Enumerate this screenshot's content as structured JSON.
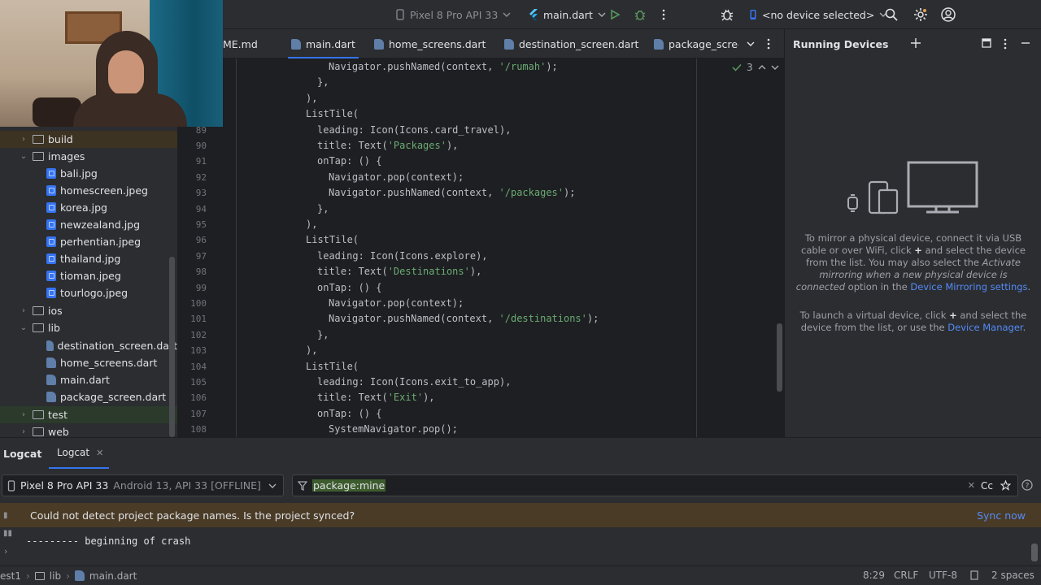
{
  "toolbar": {
    "device_config": "Pixel 8 Pro API 33",
    "run_config": "main.dart",
    "device_selector": "<no device selected>"
  },
  "tabs": [
    {
      "label": "ME.md"
    },
    {
      "label": "main.dart"
    },
    {
      "label": "home_screens.dart"
    },
    {
      "label": "destination_screen.dart"
    },
    {
      "label": "package_screen"
    }
  ],
  "project_tree": [
    {
      "label": "build",
      "kind": "folder",
      "expanded": false
    },
    {
      "label": "images",
      "kind": "folder",
      "expanded": true
    },
    {
      "label": "bali.jpg",
      "kind": "image"
    },
    {
      "label": "homescreen.jpeg",
      "kind": "image"
    },
    {
      "label": "korea.jpg",
      "kind": "image"
    },
    {
      "label": "newzealand.jpg",
      "kind": "image"
    },
    {
      "label": "perhentian.jpeg",
      "kind": "image"
    },
    {
      "label": "thailand.jpg",
      "kind": "image"
    },
    {
      "label": "tioman.jpeg",
      "kind": "image"
    },
    {
      "label": "tourlogo.jpeg",
      "kind": "image"
    },
    {
      "label": "ios",
      "kind": "folder",
      "expanded": false
    },
    {
      "label": "lib",
      "kind": "folder",
      "expanded": true
    },
    {
      "label": "destination_screen.dart",
      "kind": "dart"
    },
    {
      "label": "home_screens.dart",
      "kind": "dart"
    },
    {
      "label": "main.dart",
      "kind": "dart"
    },
    {
      "label": "package_screen.dart",
      "kind": "dart"
    },
    {
      "label": "test",
      "kind": "folder",
      "expanded": false
    },
    {
      "label": "web",
      "kind": "folder",
      "expanded": false
    }
  ],
  "editor": {
    "inspection_count": "3",
    "lines": [
      {
        "n": "",
        "indent": 4,
        "parts": [
          [
            "Navigator.pushNamed(context, ",
            ""
          ],
          [
            "'/rumah'",
            "str"
          ],
          [
            ");",
            ""
          ]
        ]
      },
      {
        "n": "",
        "indent": 3,
        "parts": [
          [
            "},",
            ""
          ]
        ]
      },
      {
        "n": "",
        "indent": 2,
        "parts": [
          [
            "),",
            ""
          ]
        ]
      },
      {
        "n": "",
        "indent": 2,
        "parts": [
          [
            "ListTile(",
            ""
          ]
        ]
      },
      {
        "n": "89",
        "indent": 3,
        "parts": [
          [
            "leading: Icon(Icons.card_travel),",
            ""
          ]
        ]
      },
      {
        "n": "90",
        "indent": 3,
        "parts": [
          [
            "title: Text(",
            ""
          ],
          [
            "'Packages'",
            "str"
          ],
          [
            "),",
            ""
          ]
        ]
      },
      {
        "n": "91",
        "indent": 3,
        "parts": [
          [
            "onTap: () {",
            ""
          ]
        ]
      },
      {
        "n": "92",
        "indent": 4,
        "parts": [
          [
            "Navigator.pop(context);",
            ""
          ]
        ]
      },
      {
        "n": "93",
        "indent": 4,
        "parts": [
          [
            "Navigator.pushNamed(context, ",
            ""
          ],
          [
            "'/packages'",
            "str"
          ],
          [
            ");",
            ""
          ]
        ]
      },
      {
        "n": "94",
        "indent": 3,
        "parts": [
          [
            "},",
            ""
          ]
        ]
      },
      {
        "n": "95",
        "indent": 2,
        "parts": [
          [
            "),",
            ""
          ]
        ]
      },
      {
        "n": "96",
        "indent": 2,
        "parts": [
          [
            "ListTile(",
            ""
          ]
        ]
      },
      {
        "n": "97",
        "indent": 3,
        "parts": [
          [
            "leading: Icon(Icons.explore),",
            ""
          ]
        ]
      },
      {
        "n": "98",
        "indent": 3,
        "parts": [
          [
            "title: Text(",
            ""
          ],
          [
            "'Destinations'",
            "str"
          ],
          [
            "),",
            ""
          ]
        ]
      },
      {
        "n": "99",
        "indent": 3,
        "parts": [
          [
            "onTap: () {",
            ""
          ]
        ]
      },
      {
        "n": "100",
        "indent": 4,
        "parts": [
          [
            "Navigator.pop(context);",
            ""
          ]
        ]
      },
      {
        "n": "101",
        "indent": 4,
        "parts": [
          [
            "Navigator.pushNamed(context, ",
            ""
          ],
          [
            "'/destinations'",
            "str"
          ],
          [
            ");",
            ""
          ]
        ]
      },
      {
        "n": "102",
        "indent": 3,
        "parts": [
          [
            "},",
            ""
          ]
        ]
      },
      {
        "n": "103",
        "indent": 2,
        "parts": [
          [
            "),",
            ""
          ]
        ]
      },
      {
        "n": "104",
        "indent": 2,
        "parts": [
          [
            "ListTile(",
            ""
          ]
        ]
      },
      {
        "n": "105",
        "indent": 3,
        "parts": [
          [
            "leading: Icon(Icons.exit_to_app),",
            ""
          ]
        ]
      },
      {
        "n": "106",
        "indent": 3,
        "parts": [
          [
            "title: Text(",
            ""
          ],
          [
            "'Exit'",
            "str"
          ],
          [
            "),",
            ""
          ]
        ]
      },
      {
        "n": "107",
        "indent": 3,
        "parts": [
          [
            "onTap: () {",
            ""
          ]
        ]
      },
      {
        "n": "108",
        "indent": 4,
        "parts": [
          [
            "SystemNavigator.pop();",
            ""
          ]
        ]
      }
    ]
  },
  "running_devices": {
    "title": "Running Devices",
    "mirror_text_1": "To mirror a physical device, connect it via USB",
    "mirror_text_2": "cable or over WiFi, click",
    "mirror_text_3": "and select the device",
    "mirror_text_4": "from the list. You may also select the",
    "mirror_text_5": "Activate",
    "mirror_text_6": "mirroring when a new physical device is",
    "mirror_text_7": "connected",
    "mirror_text_8": "option in the",
    "mirror_link": "Device Mirroring settings",
    "virtual_text_1": "To launch a virtual device, click",
    "virtual_text_2": "and select the",
    "virtual_text_3": "device from the list, or use the",
    "virtual_link": "Device Manager"
  },
  "logcat": {
    "tab_title": "Logcat",
    "tab_label": "Logcat",
    "device": "Pixel 8 Pro API 33",
    "device_detail": "Android 13, API 33 [OFFLINE]",
    "filter": "package:mine",
    "case_toggle": "Cc",
    "warning": "Could not detect project package names. Is the project synced?",
    "sync_now": "Sync now",
    "log_line": "--------- beginning of crash"
  },
  "status_bar": {
    "breadcrumb": [
      "est1",
      "lib",
      "main.dart"
    ],
    "position": "8:29",
    "line_separator": "CRLF",
    "encoding": "UTF-8",
    "indent": "2 spaces"
  },
  "colors": {
    "accent": "#3574f0",
    "string": "#6aab73",
    "run_green": "#57965c",
    "warning_bg": "#4a3b26",
    "link": "#548af7"
  }
}
